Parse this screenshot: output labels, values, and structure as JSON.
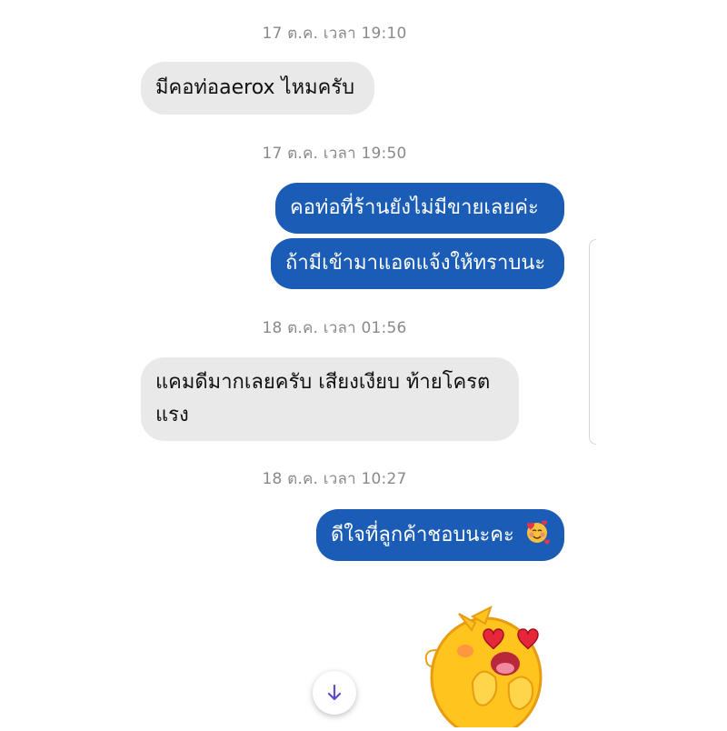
{
  "messages": [
    {
      "type": "timestamp",
      "text": "17 ต.ค. เวลา 19:10"
    },
    {
      "type": "incoming",
      "text": "มีคอท่อaerox ไหมครับ"
    },
    {
      "type": "timestamp",
      "text": "17 ต.ค. เวลา 19:50"
    },
    {
      "type": "outgoing",
      "text": "คอท่อที่ร้านยังไม่มีขายเลยค่ะ"
    },
    {
      "type": "outgoing",
      "text": "ถ้ามีเข้ามาแอดแจ้งให้ทราบนะ"
    },
    {
      "type": "timestamp",
      "text": "18 ต.ค. เวลา 01:56"
    },
    {
      "type": "incoming",
      "text_line1": "แคมดีมากเลยครับ เสียงเงียบ ท้ายโครต",
      "text_line2": "แรง"
    },
    {
      "type": "timestamp",
      "text": "18 ต.ค. เวลา 10:27"
    },
    {
      "type": "outgoing",
      "text": "ดีใจที่ลูกค้าชอบนะคะ",
      "emoji": "smiling-face-with-hearts"
    },
    {
      "type": "sticker",
      "sticker": "yellow-character-heart-eyes"
    }
  ],
  "scroll_button": {
    "icon": "arrow-down-icon"
  },
  "colors": {
    "outgoing_bubble": "#1a5cb6",
    "incoming_bubble": "#e9e9e9",
    "timestamp_text": "#8a8a8a",
    "scroll_arrow": "#5b4fcf"
  }
}
